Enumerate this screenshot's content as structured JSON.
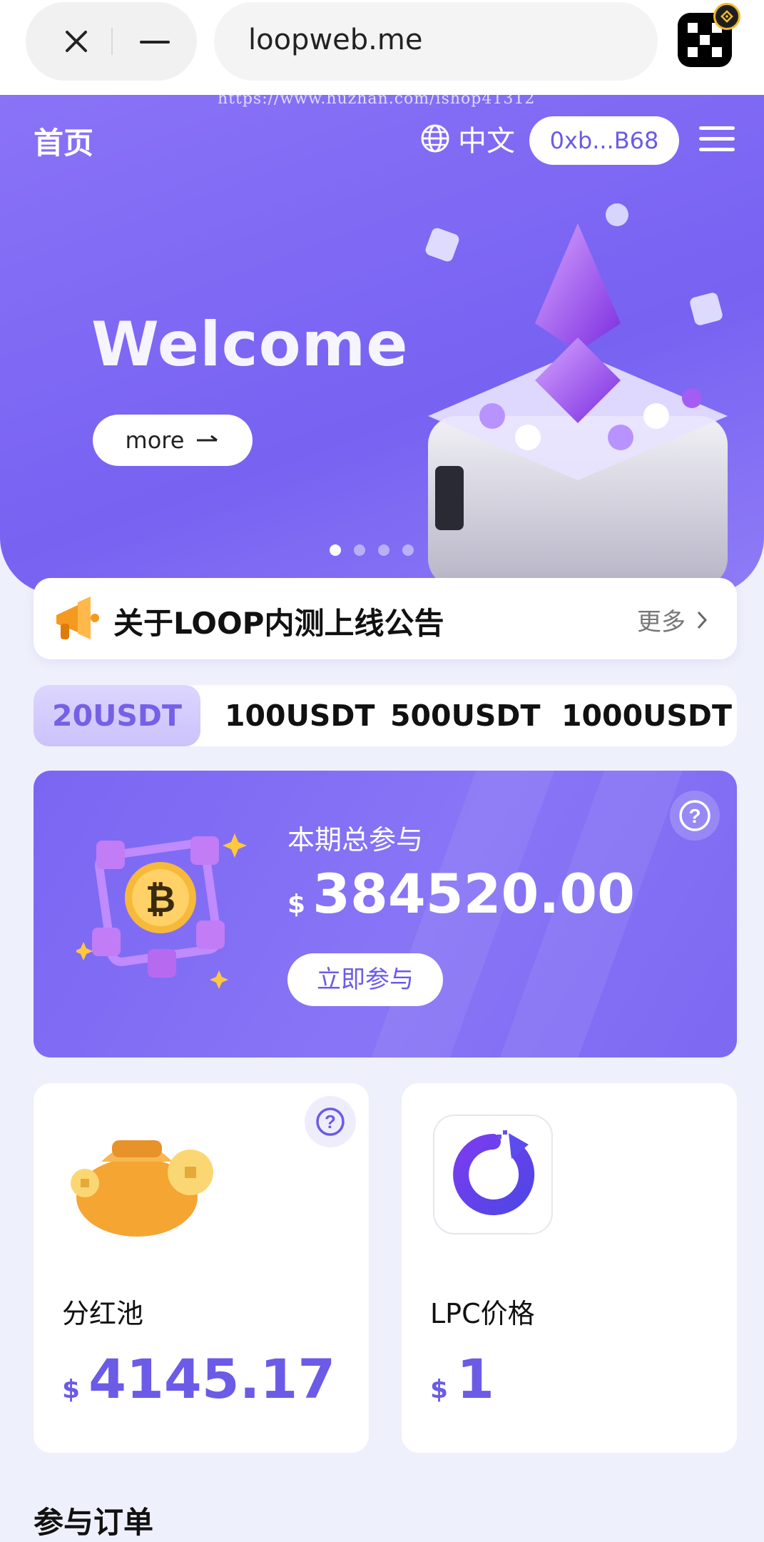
{
  "browser": {
    "url": "loopweb.me"
  },
  "watermark": "https://www.huzhan.com/ishop41312",
  "header": {
    "title": "首页",
    "language": "中文",
    "wallet_address": "0xb...B68"
  },
  "banner": {
    "headline": "Welcome",
    "more_label": "more",
    "slide_count": 4,
    "active_slide": 1
  },
  "notice": {
    "text": "关于LOOP内测上线公告",
    "more_label": "更多"
  },
  "amount_tabs": {
    "items": [
      "20USDT",
      "100USDT",
      "500USDT",
      "1000USDT"
    ],
    "selected": "20USDT"
  },
  "pool": {
    "label": "本期总参与",
    "currency": "$",
    "amount": "384520.00",
    "join_label": "立即参与"
  },
  "dividend": {
    "label": "分红池",
    "currency": "$",
    "amount": "4145.17"
  },
  "lpc": {
    "label": "LPC价格",
    "currency": "$",
    "amount": "1"
  },
  "section": {
    "orders_title": "参与订单"
  },
  "colors": {
    "accent": "#7762f2",
    "accent_text": "#6b5be6",
    "background": "#eef0fb",
    "badge_gold": "#f3ba2f"
  }
}
